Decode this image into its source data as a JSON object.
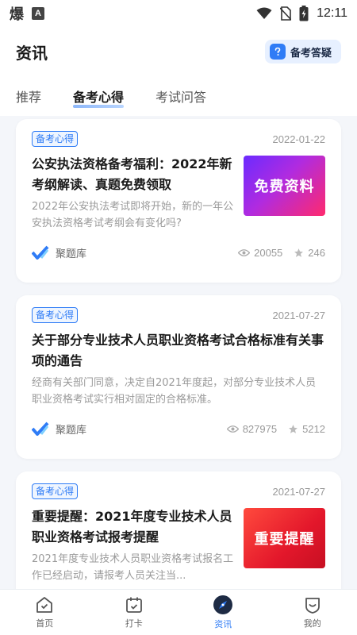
{
  "status_bar": {
    "glyph": "爆",
    "badge": "A",
    "time": "12:11"
  },
  "header": {
    "title": "资讯",
    "qa_label": "备考答疑"
  },
  "tabs": [
    {
      "label": "推荐"
    },
    {
      "label": "备考心得"
    },
    {
      "label": "考试问答"
    }
  ],
  "articles": [
    {
      "tag": "备考心得",
      "date": "2022-01-22",
      "title": "公安执法资格备考福利：2022年新考纲解读、真题免费领取",
      "desc": "2022年公安执法考试即将开始，新的一年公安执法资格考试考纲会有变化吗?",
      "thumb_text": "免费资料",
      "source": "聚题库",
      "views": "20055",
      "stars": "246"
    },
    {
      "tag": "备考心得",
      "date": "2021-07-27",
      "title": "关于部分专业技术人员职业资格考试合格标准有关事项的通告",
      "desc": "经商有关部门同意，决定自2021年度起，对部分专业技术人员职业资格考试实行相对固定的合格标准。",
      "source": "聚题库",
      "views": "827975",
      "stars": "5212"
    },
    {
      "tag": "备考心得",
      "date": "2021-07-27",
      "title": "重要提醒：2021年度专业技术人员职业资格考试报考提醒",
      "desc": "2021年度专业技术人员职业资格考试报名工作已经启动，请报考人员关注当...",
      "thumb_text": "重要提醒"
    }
  ],
  "bottom_nav": [
    {
      "label": "首页"
    },
    {
      "label": "打卡"
    },
    {
      "label": "资讯"
    },
    {
      "label": "我的"
    }
  ],
  "colors": {
    "accent": "#2f7cf6",
    "background": "#f4f6fa"
  }
}
